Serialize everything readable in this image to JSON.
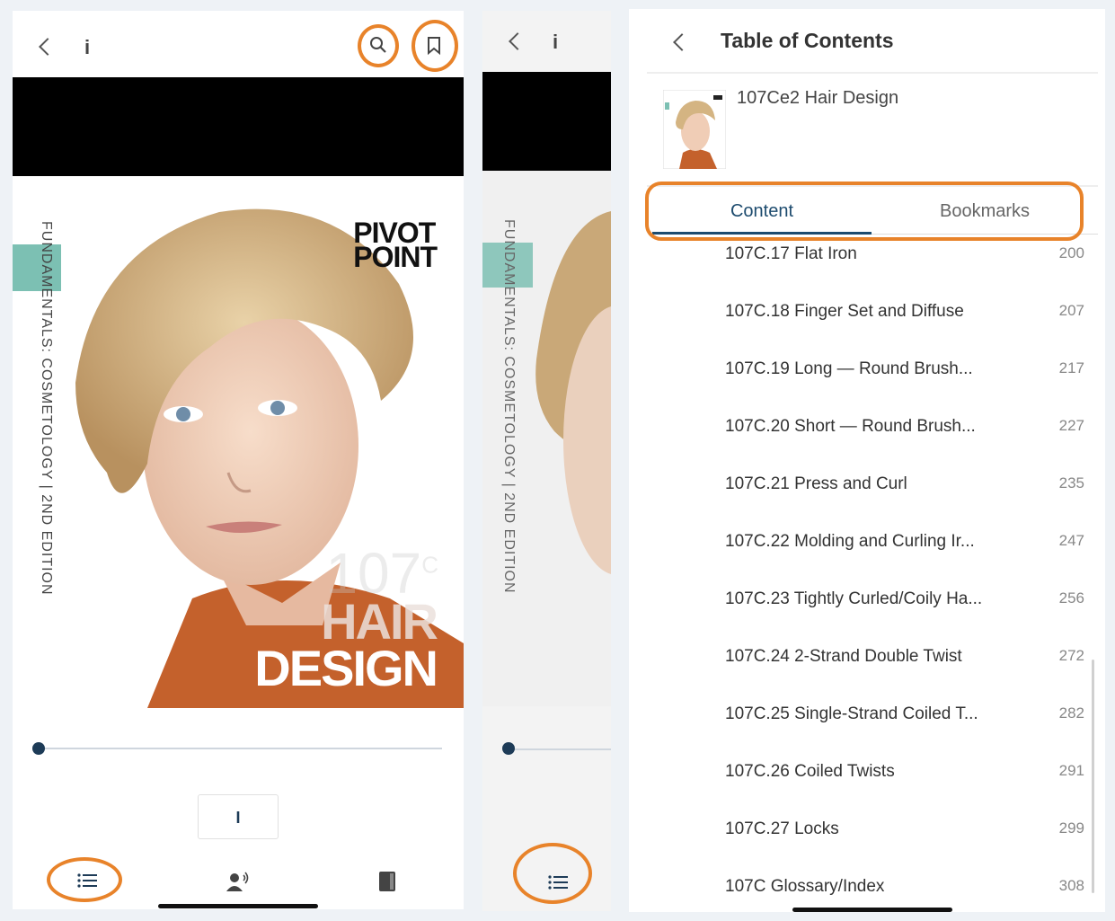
{
  "reader": {
    "info_label": "i",
    "cover": {
      "spine_text": "FUNDAMENTALS: COSMETOLOGY | 2ND EDITION",
      "brand_line1": "PIVOT",
      "brand_line2": "POINT",
      "book_number": "107",
      "book_number_sup": "C",
      "title_line1": "HAIR",
      "title_line2": "DESIGN"
    },
    "page_label": "I",
    "progress": 0.0
  },
  "icons": {
    "back": "chevron-left-icon",
    "search": "search-icon",
    "bookmark": "bookmark-icon",
    "toc": "list-icon",
    "audio": "audio-person-icon",
    "book": "book-icon"
  },
  "accent_color": "#e8832a",
  "toc": {
    "title": "Table of Contents",
    "book_name": "107Ce2 Hair Design",
    "tabs": [
      "Content",
      "Bookmarks"
    ],
    "active_tab": "Content",
    "items": [
      {
        "label": "107C.17 Flat Iron",
        "page": "200"
      },
      {
        "label": "107C.18 Finger Set and Diffuse",
        "page": "207"
      },
      {
        "label": "107C.19 Long — Round Brush...",
        "page": "217"
      },
      {
        "label": "107C.20 Short — Round Brush...",
        "page": "227"
      },
      {
        "label": "107C.21 Press and Curl",
        "page": "235"
      },
      {
        "label": "107C.22 Molding and Curling Ir...",
        "page": "247"
      },
      {
        "label": "107C.23 Tightly Curled/Coily Ha...",
        "page": "256"
      },
      {
        "label": "107C.24 2-Strand Double Twist",
        "page": "272"
      },
      {
        "label": "107C.25 Single-Strand Coiled T...",
        "page": "282"
      },
      {
        "label": "107C.26 Coiled Twists",
        "page": "291"
      },
      {
        "label": "107C.27 Locks",
        "page": "299"
      },
      {
        "label": "107C Glossary/Index",
        "page": "308"
      }
    ]
  }
}
